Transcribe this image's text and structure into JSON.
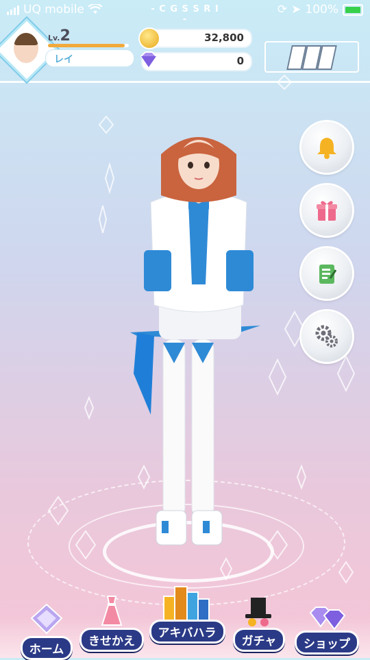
{
  "status_bar": {
    "carrier": "UQ mobile",
    "battery_percent": "100%"
  },
  "game_title": "- C G S S R I -",
  "player": {
    "level_prefix": "Lv.",
    "level": "2",
    "name": "レイ",
    "exp_progress": 0.95
  },
  "currency": {
    "coins": "32,800",
    "gems": "0"
  },
  "side_buttons": [
    {
      "name": "notification",
      "icon": "bell-icon"
    },
    {
      "name": "present",
      "icon": "gift-icon"
    },
    {
      "name": "mission",
      "icon": "checklist-icon"
    },
    {
      "name": "settings",
      "icon": "gear-icon"
    }
  ],
  "bottom_nav": {
    "home": "ホーム",
    "dressup": "きせかえ",
    "akihabara": "アキバハラ",
    "gacha": "ガチャ",
    "shop": "ショップ"
  },
  "colors": {
    "accent": "#2b3a86",
    "bell": "#f5b323",
    "gift": "#ee6a8c",
    "checklist": "#5bb85f",
    "gear": "#6e6e78"
  }
}
